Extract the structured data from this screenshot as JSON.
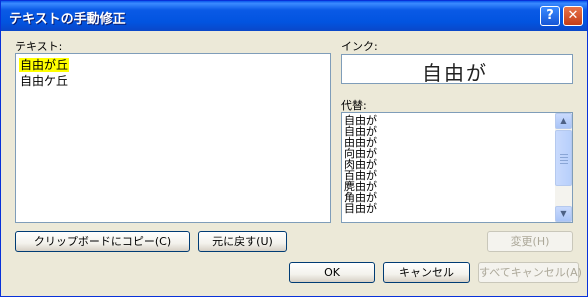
{
  "window": {
    "title": "テキストの手動修正",
    "help_symbol": "?",
    "close_symbol": "✕"
  },
  "text_panel": {
    "label": "テキスト:",
    "items": [
      "自由が丘",
      "自由ケ丘"
    ]
  },
  "ink_panel": {
    "label": "インク:",
    "ink_text": "自由が"
  },
  "alternates_panel": {
    "label": "代替:",
    "items": [
      "自由が",
      "自由が",
      "由由が",
      "向由が",
      "肉由が",
      "百由が",
      "麂由が",
      "角由が",
      "目由が"
    ]
  },
  "buttons": {
    "copy_to_clipboard": "クリップボードにコピー(C)",
    "undo": "元に戻す(U)",
    "change": "変更(H)",
    "ok": "OK",
    "cancel": "キャンセル",
    "cancel_all": "すべてキャンセル(A)"
  }
}
